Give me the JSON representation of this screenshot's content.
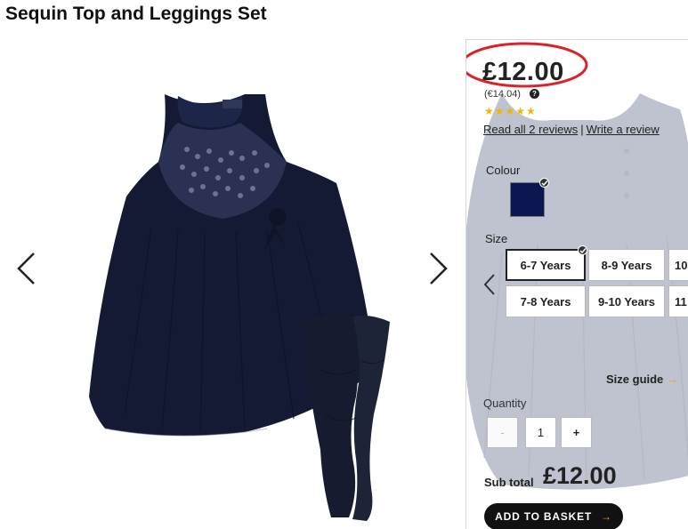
{
  "product": {
    "title": "Sequin Top and Leggings Set",
    "price": "£12.00",
    "euro_price": "(€14.04)",
    "info_icon": "info-icon",
    "stars": "★★★★★",
    "rating": 5,
    "reviews_link": "Read all 2 reviews",
    "reviews_separator": "|",
    "write_review_link": "Write a review"
  },
  "gallery": {
    "prev_icon": "chevron-left-icon",
    "next_icon": "chevron-right-icon"
  },
  "colour": {
    "label": "Colour",
    "selected": "navy",
    "swatch_color": "#0c1650"
  },
  "size": {
    "label": "Size",
    "options": [
      "6-7 Years",
      "8-9 Years",
      "10",
      "7-8 Years",
      "9-10 Years",
      "11"
    ],
    "selected": "6-7 Years"
  },
  "size_guide": {
    "label": "Size guide",
    "arrow": "→"
  },
  "quantity": {
    "label": "Quantity",
    "minus": "-",
    "value": "1",
    "plus": "+"
  },
  "subtotal": {
    "label": "Sub total",
    "value": "£12.00"
  },
  "basket": {
    "label": "ADD TO BASKET",
    "arrow": "→"
  },
  "colors": {
    "accent": "#e8a800",
    "annotation": "#d9232a",
    "dress": "#141a33"
  }
}
